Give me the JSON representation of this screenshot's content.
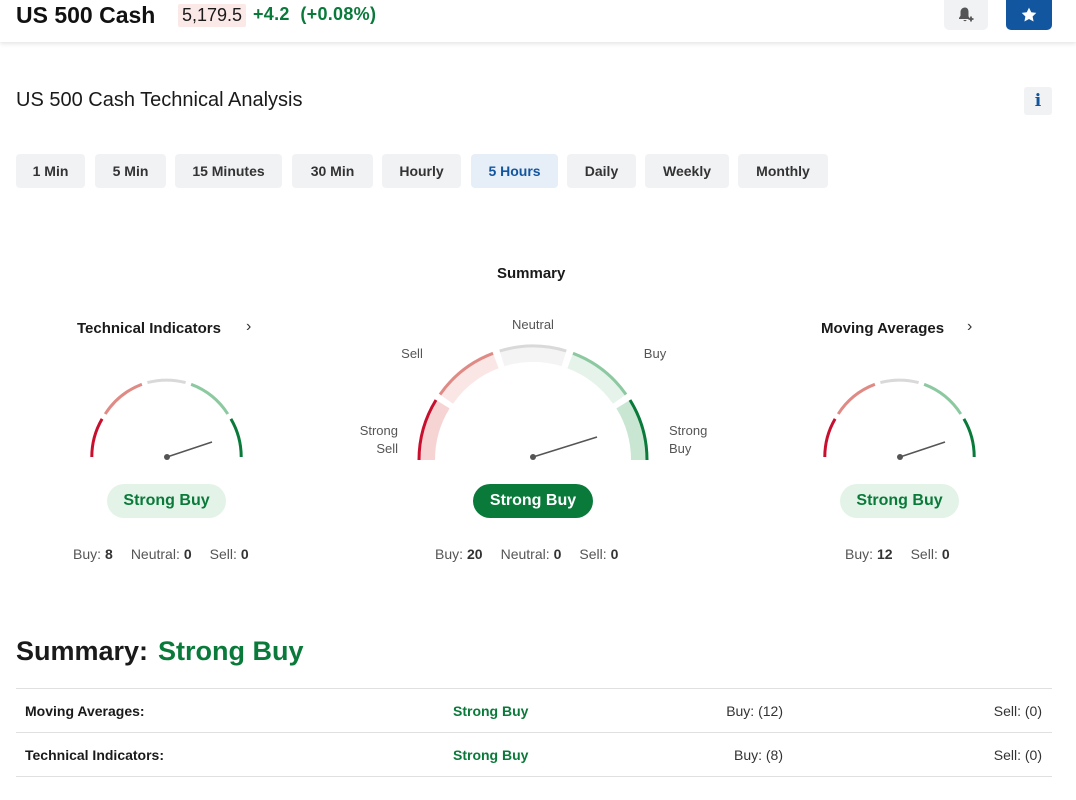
{
  "header": {
    "instrument": "US 500 Cash",
    "price": "5,179.5",
    "change": "+4.2",
    "change_pct": "(+0.08%)",
    "icons": {
      "alert": "bell-plus-icon",
      "watchlist": "star-icon"
    }
  },
  "page_title": "US 500 Cash Technical Analysis",
  "info_label": "i",
  "timeframes": {
    "items": [
      "1 Min",
      "5 Min",
      "15 Minutes",
      "30 Min",
      "Hourly",
      "5 Hours",
      "Daily",
      "Weekly",
      "Monthly"
    ],
    "selected": "5 Hours"
  },
  "gauges": {
    "technical": {
      "title": "Technical Indicators",
      "verdict": "Strong Buy",
      "counts": {
        "buy_label": "Buy:",
        "buy": "8",
        "neutral_label": "Neutral:",
        "neutral": "0",
        "sell_label": "Sell:",
        "sell": "0"
      }
    },
    "summary": {
      "title": "Summary",
      "zones": {
        "neutral": "Neutral",
        "sell": "Sell",
        "buy": "Buy",
        "strong_sell_1": "Strong",
        "strong_sell_2": "Sell",
        "strong_buy_1": "Strong",
        "strong_buy_2": "Buy"
      },
      "verdict": "Strong Buy",
      "counts": {
        "buy_label": "Buy:",
        "buy": "20",
        "neutral_label": "Neutral:",
        "neutral": "0",
        "sell_label": "Sell:",
        "sell": "0"
      }
    },
    "moving": {
      "title": "Moving Averages",
      "verdict": "Strong Buy",
      "counts": {
        "buy_label": "Buy:",
        "buy": "12",
        "sell_label": "Sell:",
        "sell": "0"
      }
    }
  },
  "summary": {
    "label": "Summary:",
    "value": "Strong Buy",
    "rows": [
      {
        "name": "Moving Averages:",
        "signal": "Strong Buy",
        "buy": "Buy: (12)",
        "sell": "Sell: (0)"
      },
      {
        "name": "Technical Indicators:",
        "signal": "Strong Buy",
        "buy": "Buy: (8)",
        "sell": "Sell: (0)"
      }
    ]
  },
  "colors": {
    "strong_sell": "#c8102e",
    "sell": "#e08a85",
    "neutral": "#d9d9d9",
    "buy": "#8cc9a0",
    "strong_buy": "#0a7a3a",
    "accent": "#1256a0"
  }
}
